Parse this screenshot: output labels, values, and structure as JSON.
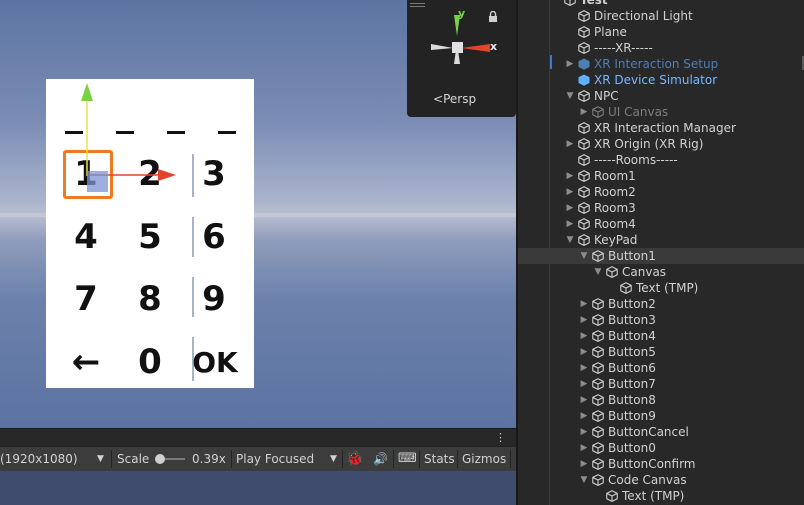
{
  "scene": {
    "gizmo": {
      "axis_y": "y",
      "axis_x": "x",
      "projection": "Persp",
      "projection_icon": "back-arrow-icon",
      "lock_icon": "lock-icon"
    },
    "keypad": {
      "keys": [
        "1",
        "2",
        "3",
        "4",
        "5",
        "6",
        "7",
        "8",
        "9",
        "←",
        "0",
        "OK"
      ]
    }
  },
  "game_toolbar": {
    "resolution": "(1920x1080)",
    "scale_label": "Scale",
    "scale_value": "0.39x",
    "play_mode": "Play Focused",
    "stats": "Stats",
    "gizmos": "Gizmos"
  },
  "hierarchy": {
    "items": [
      {
        "label": "Test",
        "depth": 0,
        "state": "none"
      },
      {
        "label": "Directional Light",
        "depth": 1,
        "state": "none"
      },
      {
        "label": "Plane",
        "depth": 1,
        "state": "none"
      },
      {
        "label": "-----XR-----",
        "depth": 1,
        "state": "none"
      },
      {
        "label": "XR Interaction Setup",
        "depth": 1,
        "state": "collapsed",
        "style": "prefab-inactive"
      },
      {
        "label": "XR Device Simulator",
        "depth": 1,
        "state": "none",
        "style": "prefab"
      },
      {
        "label": "NPC",
        "depth": 1,
        "state": "expanded"
      },
      {
        "label": "UI Canvas",
        "depth": 2,
        "state": "collapsed",
        "style": "inactive"
      },
      {
        "label": "XR Interaction Manager",
        "depth": 1,
        "state": "none"
      },
      {
        "label": "XR Origin (XR Rig)",
        "depth": 1,
        "state": "collapsed"
      },
      {
        "label": "-----Rooms-----",
        "depth": 1,
        "state": "none"
      },
      {
        "label": "Room1",
        "depth": 1,
        "state": "collapsed"
      },
      {
        "label": "Room2",
        "depth": 1,
        "state": "collapsed"
      },
      {
        "label": "Room3",
        "depth": 1,
        "state": "collapsed"
      },
      {
        "label": "Room4",
        "depth": 1,
        "state": "collapsed"
      },
      {
        "label": "KeyPad",
        "depth": 1,
        "state": "expanded"
      },
      {
        "label": "Button1",
        "depth": 2,
        "state": "expanded",
        "selected": true
      },
      {
        "label": "Canvas",
        "depth": 3,
        "state": "expanded"
      },
      {
        "label": "Text (TMP)",
        "depth": 4,
        "state": "none"
      },
      {
        "label": "Button2",
        "depth": 2,
        "state": "collapsed"
      },
      {
        "label": "Button3",
        "depth": 2,
        "state": "collapsed"
      },
      {
        "label": "Button4",
        "depth": 2,
        "state": "collapsed"
      },
      {
        "label": "Button5",
        "depth": 2,
        "state": "collapsed"
      },
      {
        "label": "Button6",
        "depth": 2,
        "state": "collapsed"
      },
      {
        "label": "Button7",
        "depth": 2,
        "state": "collapsed"
      },
      {
        "label": "Button8",
        "depth": 2,
        "state": "collapsed"
      },
      {
        "label": "Button9",
        "depth": 2,
        "state": "collapsed"
      },
      {
        "label": "ButtonCancel",
        "depth": 2,
        "state": "collapsed"
      },
      {
        "label": "Button0",
        "depth": 2,
        "state": "collapsed"
      },
      {
        "label": "ButtonConfirm",
        "depth": 2,
        "state": "collapsed"
      },
      {
        "label": "Code Canvas",
        "depth": 2,
        "state": "expanded"
      },
      {
        "label": "Text (TMP)",
        "depth": 3,
        "state": "none"
      }
    ]
  },
  "colors": {
    "accent": "#3a79d8",
    "prefab": "#7ab7ff",
    "selection": "#f07a20",
    "x_axis": "#e2432a",
    "y_axis": "#79d147"
  }
}
